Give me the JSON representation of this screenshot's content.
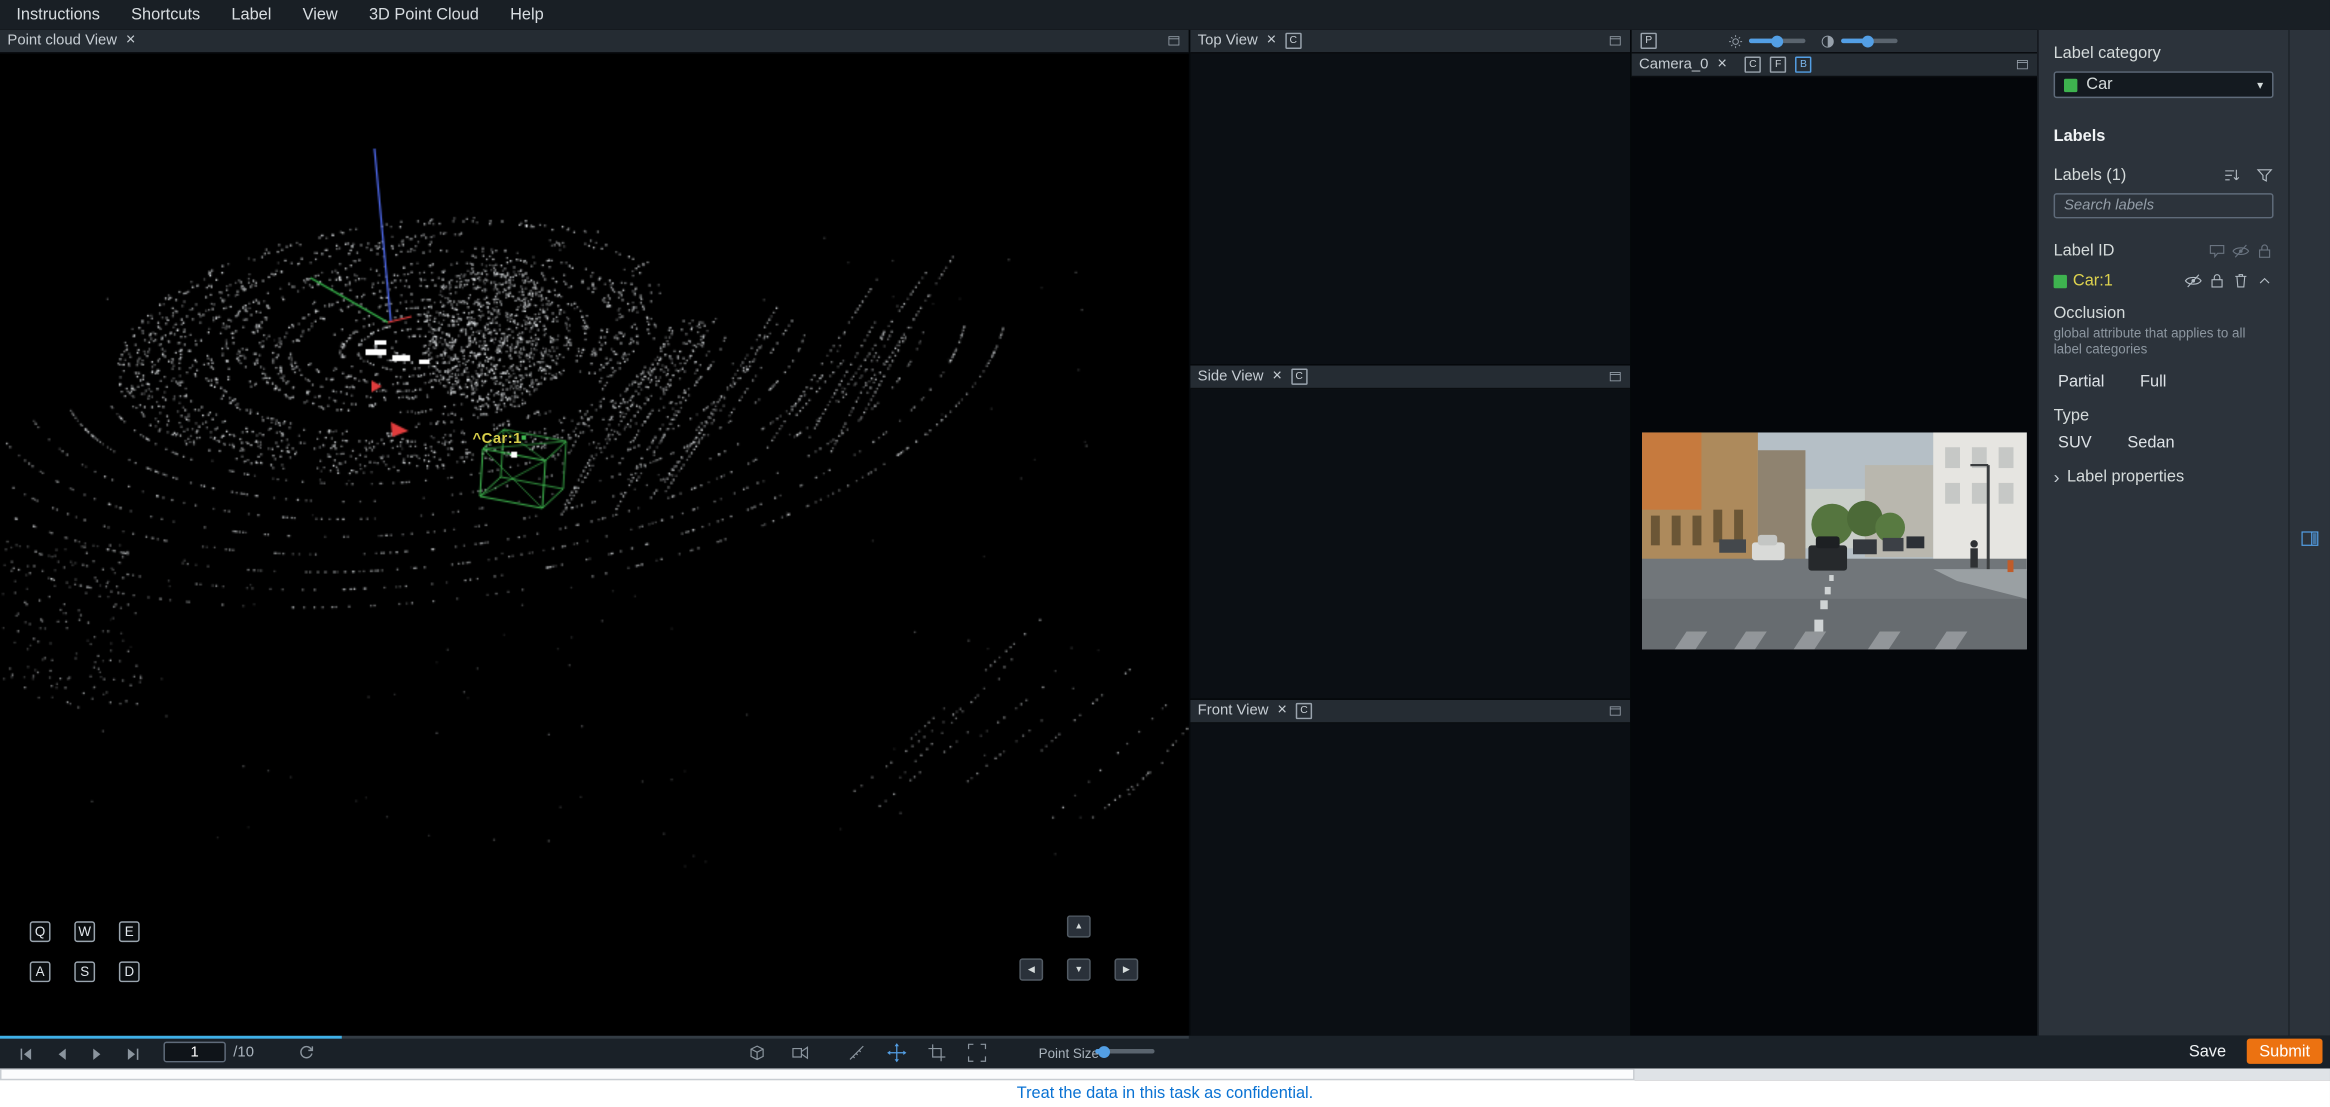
{
  "menu": {
    "items": [
      "Instructions",
      "Shortcuts",
      "Label",
      "View",
      "3D Point Cloud",
      "Help"
    ]
  },
  "icons": {
    "close": "×",
    "chevron_down": "▾",
    "chevron_right": "›",
    "nav_up": "▲",
    "nav_down": "▼",
    "nav_left": "◀",
    "nav_right": "▶"
  },
  "point_cloud": {
    "title": "Point cloud View",
    "box_label": "^Car:1",
    "keys": [
      "Q",
      "W",
      "E",
      "A",
      "S",
      "D"
    ]
  },
  "views": {
    "top": {
      "title": "Top View",
      "center": "C"
    },
    "side": {
      "title": "Side View",
      "center": "C"
    },
    "front": {
      "title": "Front View",
      "center": "C"
    }
  },
  "camera": {
    "title": "Camera_0",
    "projection": "P",
    "buttons": {
      "c": "C",
      "f": "F",
      "b": "B"
    }
  },
  "sidebar": {
    "label_category_heading": "Label category",
    "category_value": "Car",
    "labels_heading": "Labels",
    "labels_count": "Labels (1)",
    "search_placeholder": "Search labels",
    "label_id_heading": "Label ID",
    "label_name": "Car:1",
    "occlusion_heading": "Occlusion",
    "occlusion_description": "global attribute that applies to all label categories",
    "occlusion_options": [
      "Partial",
      "Full"
    ],
    "type_heading": "Type",
    "type_options": [
      "SUV",
      "Sedan"
    ],
    "label_properties_label": "Label properties"
  },
  "bottom_bar": {
    "frame_value": "1",
    "frame_total": "/10",
    "point_size_label": "Point Size",
    "save_label": "Save",
    "submit_label": "Submit"
  },
  "footer": {
    "notice": "Treat the data in this task as confidential."
  },
  "colors": {
    "accent_blue": "#539fe5",
    "submit_orange": "#ec7211",
    "label_green": "#3eb34f",
    "label_yellow": "#d9d14f",
    "notice_blue": "#0972d3"
  }
}
